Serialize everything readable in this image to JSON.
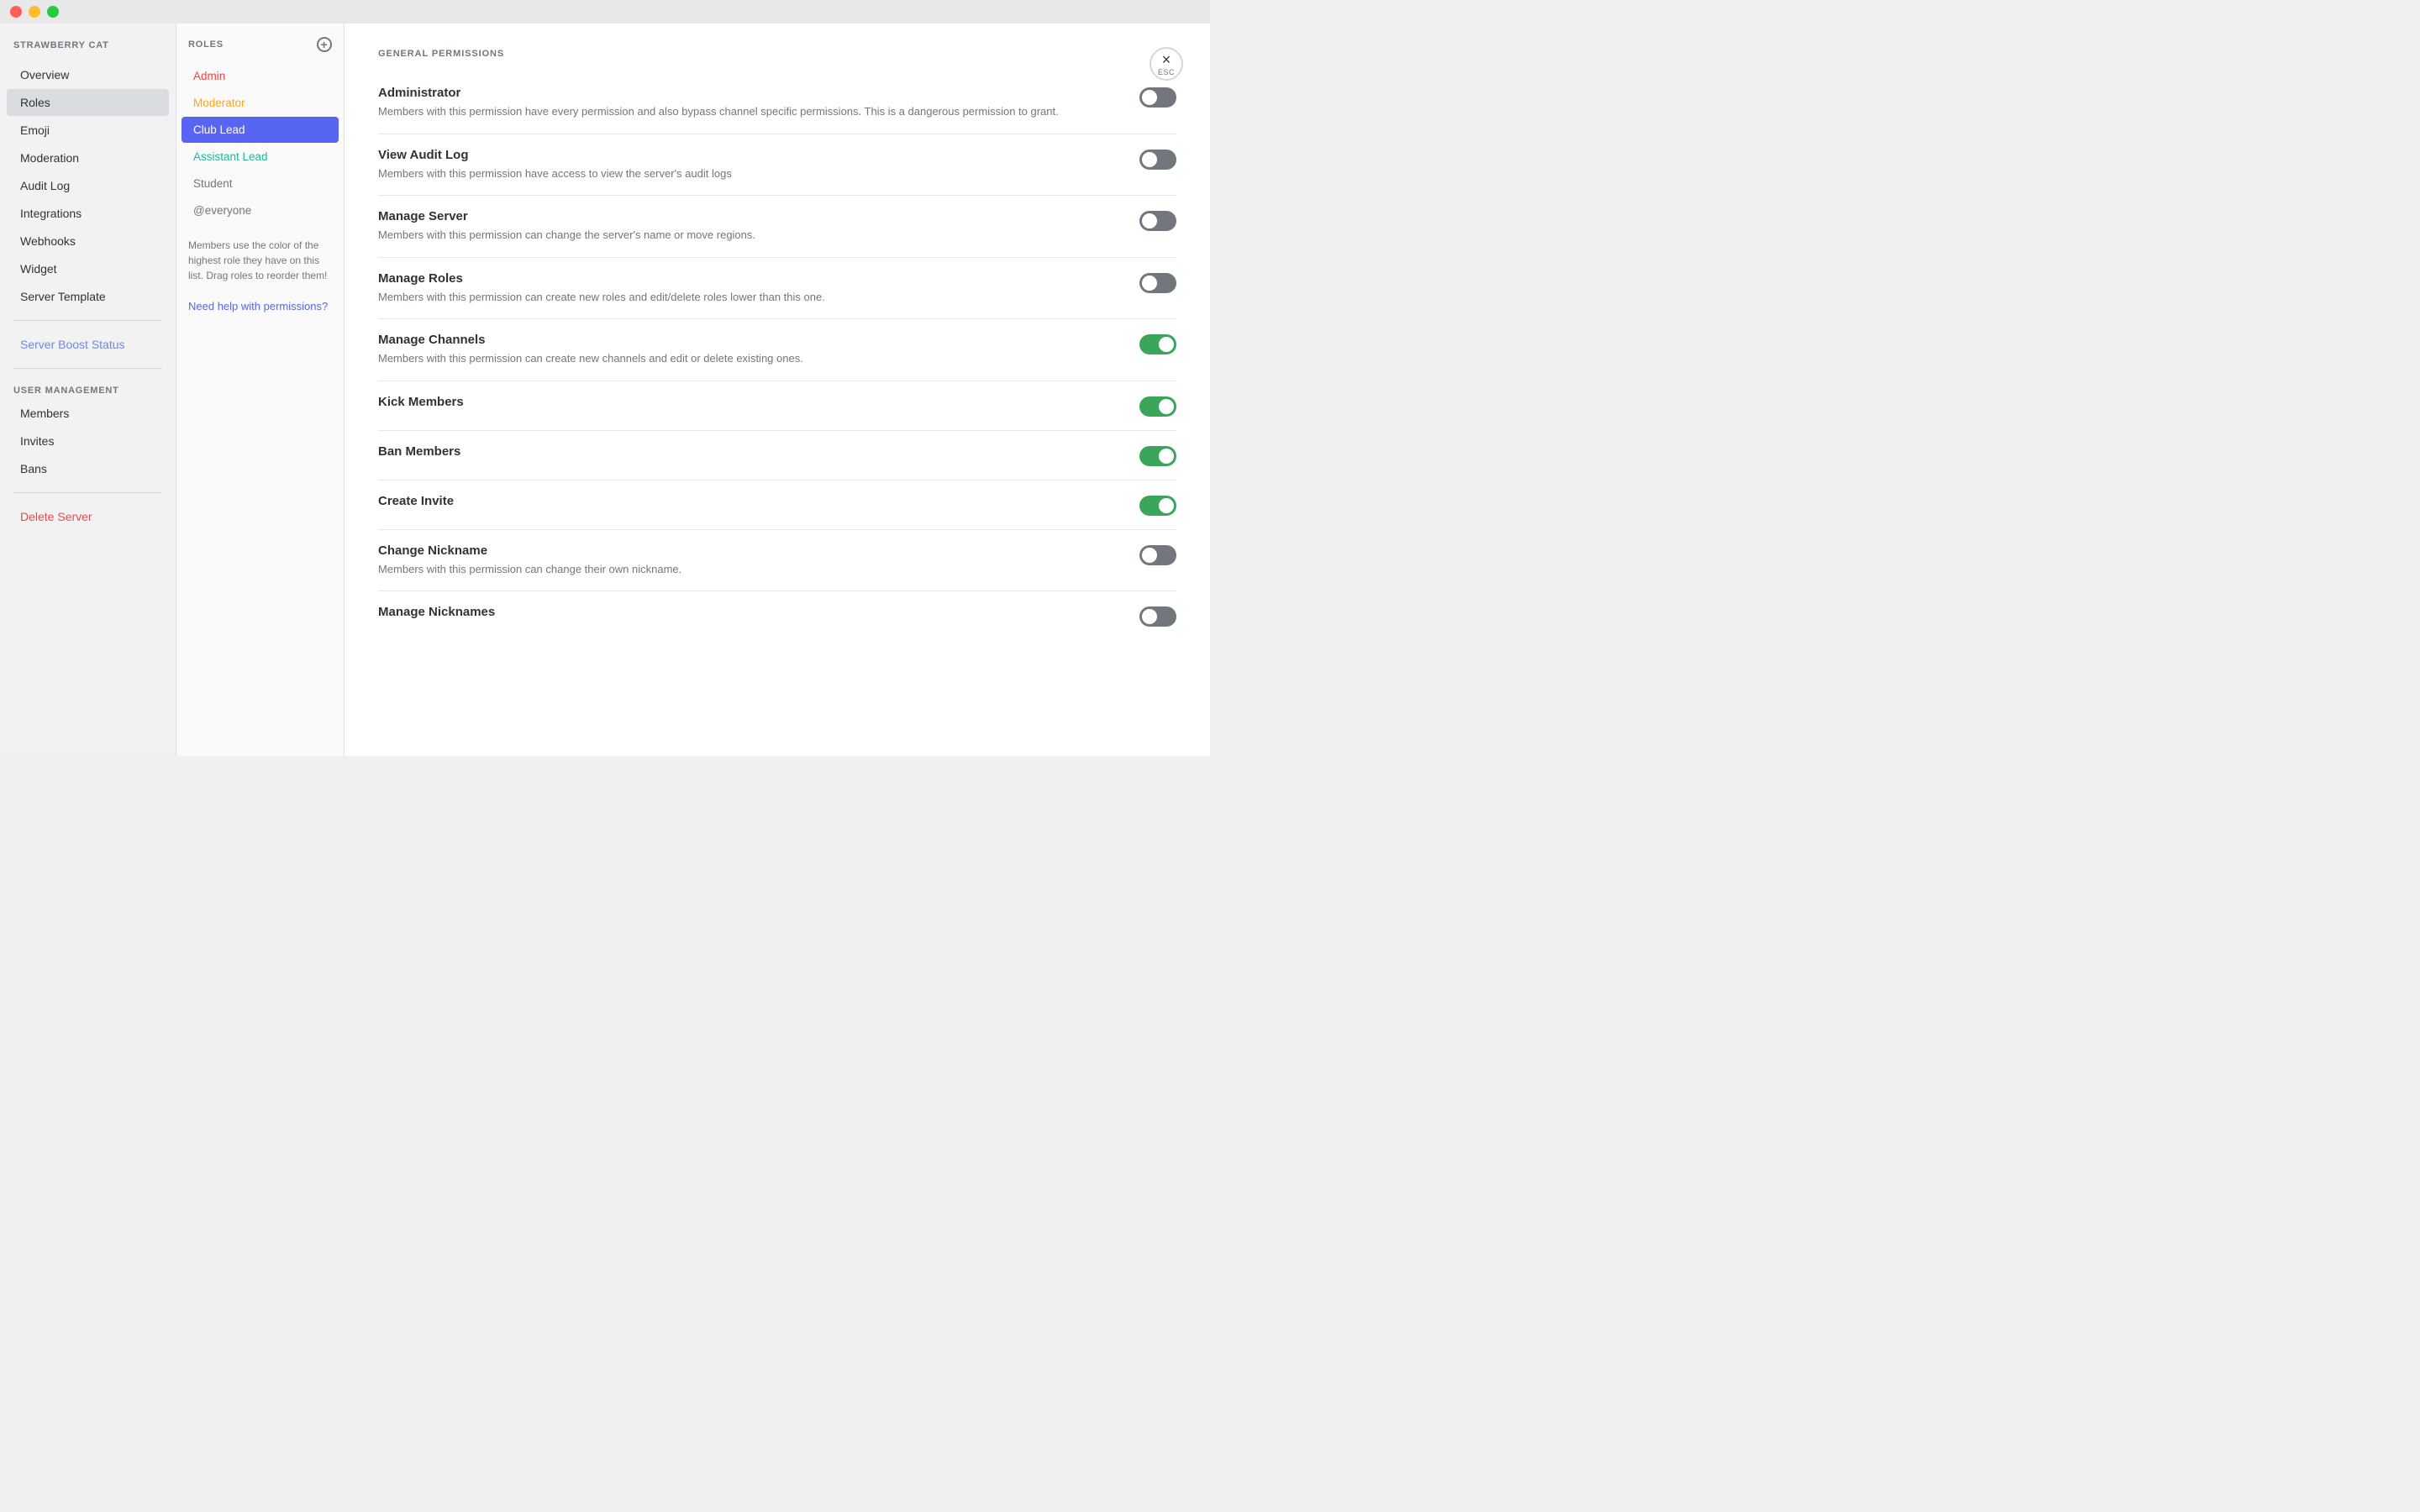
{
  "titlebar": {
    "close": "close",
    "minimize": "minimize",
    "maximize": "maximize"
  },
  "sidebar": {
    "server_name": "STRAWBERRY CAT",
    "items": [
      {
        "label": "Overview",
        "id": "overview",
        "active": false
      },
      {
        "label": "Roles",
        "id": "roles",
        "active": true
      },
      {
        "label": "Emoji",
        "id": "emoji",
        "active": false
      },
      {
        "label": "Moderation",
        "id": "moderation",
        "active": false
      },
      {
        "label": "Audit Log",
        "id": "audit-log",
        "active": false
      },
      {
        "label": "Integrations",
        "id": "integrations",
        "active": false
      },
      {
        "label": "Webhooks",
        "id": "webhooks",
        "active": false
      },
      {
        "label": "Widget",
        "id": "widget",
        "active": false
      },
      {
        "label": "Server Template",
        "id": "server-template",
        "active": false
      }
    ],
    "boost": {
      "label": "Server Boost Status",
      "id": "boost"
    },
    "user_management_label": "USER MANAGEMENT",
    "user_management_items": [
      {
        "label": "Members",
        "id": "members"
      },
      {
        "label": "Invites",
        "id": "invites"
      },
      {
        "label": "Bans",
        "id": "bans"
      }
    ],
    "delete_server": "Delete Server"
  },
  "roles_panel": {
    "header": "ROLES",
    "roles": [
      {
        "label": "Admin",
        "color": "red",
        "selected": false
      },
      {
        "label": "Moderator",
        "color": "yellow",
        "selected": false
      },
      {
        "label": "Club Lead",
        "color": "blue",
        "selected": true
      },
      {
        "label": "Assistant Lead",
        "color": "teal",
        "selected": false
      },
      {
        "label": "Student",
        "color": "gray",
        "selected": false
      },
      {
        "label": "@everyone",
        "color": "gray",
        "selected": false
      }
    ],
    "hint": "Members use the color of the highest role they have on this list. Drag roles to reorder them!",
    "help_link": "Need help with permissions?"
  },
  "permissions": {
    "section_label": "GENERAL PERMISSIONS",
    "items": [
      {
        "name": "Administrator",
        "desc": "Members with this permission have every permission and also bypass channel specific permissions. This is a dangerous permission to grant.",
        "on": false
      },
      {
        "name": "View Audit Log",
        "desc": "Members with this permission have access to view the server's audit logs",
        "on": false
      },
      {
        "name": "Manage Server",
        "desc": "Members with this permission can change the server's name or move regions.",
        "on": false
      },
      {
        "name": "Manage Roles",
        "desc": "Members with this permission can create new roles and edit/delete roles lower than this one.",
        "on": false
      },
      {
        "name": "Manage Channels",
        "desc": "Members with this permission can create new channels and edit or delete existing ones.",
        "on": true
      },
      {
        "name": "Kick Members",
        "desc": "",
        "on": true
      },
      {
        "name": "Ban Members",
        "desc": "",
        "on": true
      },
      {
        "name": "Create Invite",
        "desc": "",
        "on": true
      },
      {
        "name": "Change Nickname",
        "desc": "Members with this permission can change their own nickname.",
        "on": false
      },
      {
        "name": "Manage Nicknames",
        "desc": "",
        "on": false
      }
    ]
  },
  "esc": {
    "symbol": "×",
    "label": "ESC"
  }
}
